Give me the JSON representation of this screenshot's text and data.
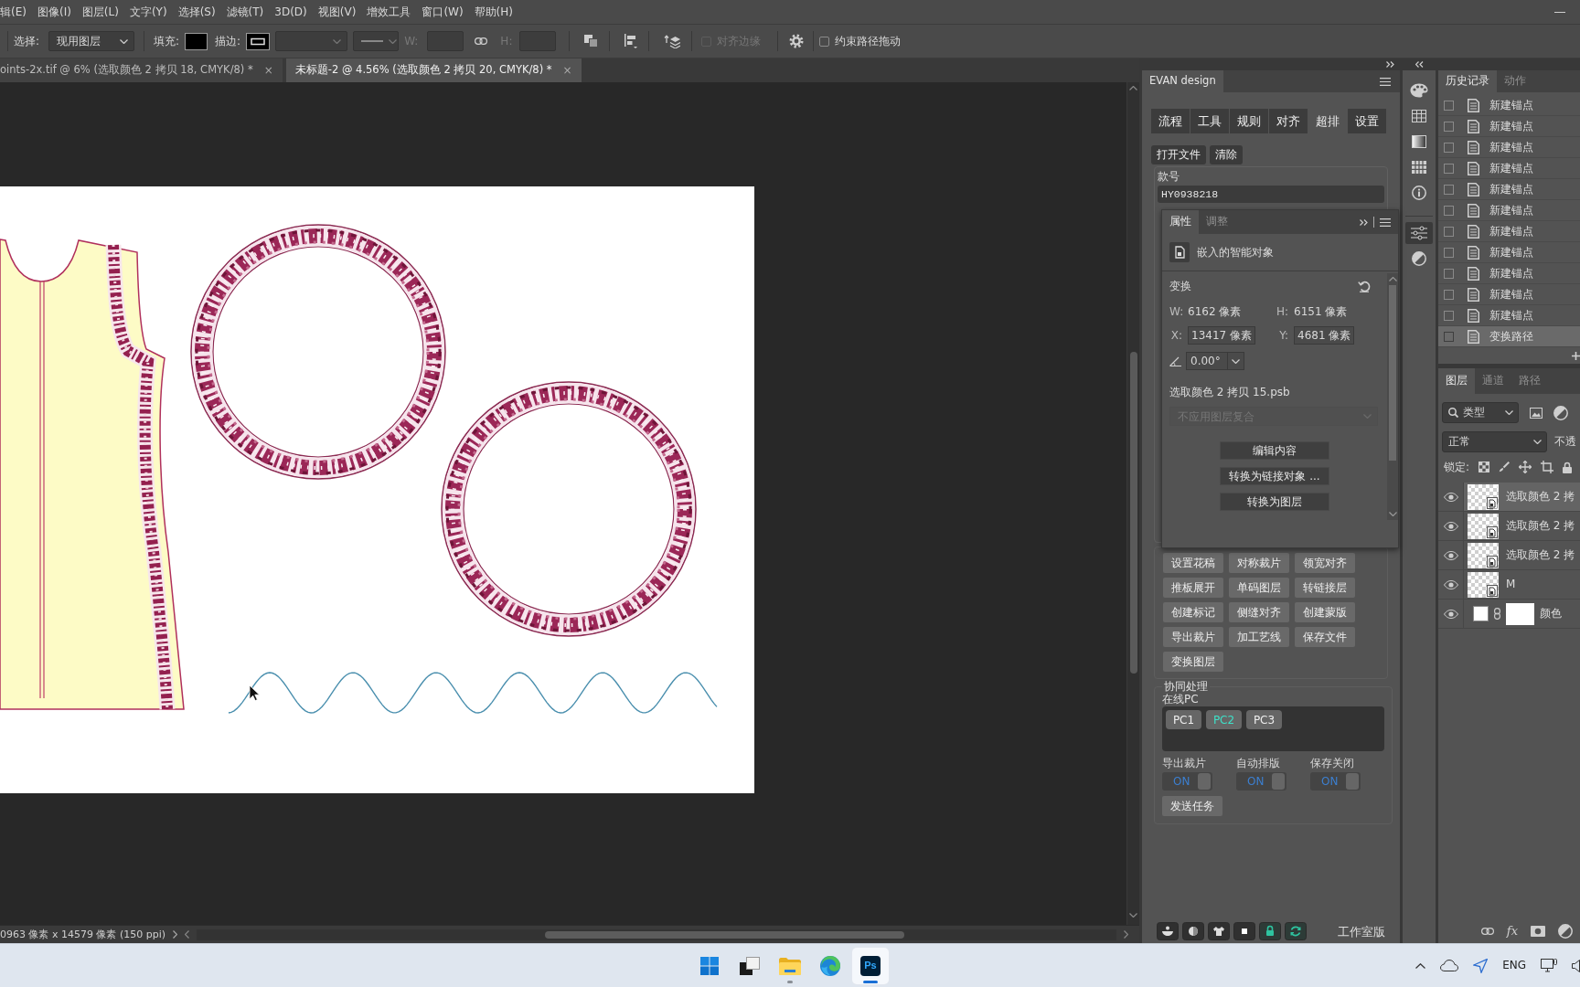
{
  "menu_bar": {
    "items": [
      "辑(E)",
      "图像(I)",
      "图层(L)",
      "文字(Y)",
      "选择(S)",
      "滤镜(T)",
      "3D(D)",
      "视图(V)",
      "增效工具",
      "窗口(W)",
      "帮助(H)"
    ]
  },
  "options_bar": {
    "select_label": "选择:",
    "select_value": "现用图层",
    "fill_label": "填充:",
    "stroke_label": "描边:",
    "w_label": "W:",
    "h_label": "H:",
    "align_edges": {
      "label": "对齐边缘",
      "checked": false,
      "disabled": true
    },
    "constrain_path": {
      "label": "约束路径拖动",
      "checked": false
    }
  },
  "document_tabs": [
    {
      "title": "oints-2x.tif @ 6% (选取颜色 2 拷贝 18, CMYK/8) *",
      "close": "×",
      "selected": false
    },
    {
      "title": "未标题-2 @ 4.56% (选取颜色 2 拷贝 20, CMYK/8) *",
      "close": "×",
      "selected": true
    }
  ],
  "status_bar": {
    "info": "0963 像素 x 14579 像素 (150 ppi)"
  },
  "evan_panel": {
    "title": "EVAN design",
    "tabs": [
      {
        "label": "流程",
        "selected": false
      },
      {
        "label": "工具",
        "selected": false
      },
      {
        "label": "规则",
        "selected": false
      },
      {
        "label": "对齐",
        "selected": false
      },
      {
        "label": "超排",
        "selected": true
      },
      {
        "label": "设置",
        "selected": false
      }
    ],
    "file_buttons": [
      "打开文件",
      "清除"
    ],
    "style_number": {
      "label": "款号",
      "value": "HY0938218"
    },
    "tool_buttons": [
      "设置花稿",
      "对称裁片",
      "领宽对齐",
      "推板展开",
      "单码图层",
      "转链接层",
      "创建标记",
      "侧缝对齐",
      "创建蒙版",
      "导出裁片",
      "加工艺线",
      "保存文件",
      "变换图层"
    ],
    "sync": {
      "title": "协同处理",
      "online_label": "在线PC",
      "pcs": [
        {
          "label": "PC1",
          "selected": false
        },
        {
          "label": "PC2",
          "selected": true
        },
        {
          "label": "PC3",
          "selected": false
        }
      ],
      "toggles": [
        {
          "label": "导出裁片",
          "text": "ON",
          "on": true
        },
        {
          "label": "自动排版",
          "text": "ON",
          "on": true
        },
        {
          "label": "保存关闭",
          "text": "ON",
          "on": true
        }
      ],
      "send_button": "发送任务"
    },
    "edition": "工作室版"
  },
  "properties_panel": {
    "tabs": [
      {
        "label": "属性",
        "selected": true
      },
      {
        "label": "调整",
        "selected": false
      }
    ],
    "object_type": "嵌入的智能对象",
    "section": "变换",
    "size": [
      {
        "label": "W:",
        "value": "6162 像素"
      },
      {
        "label": "H:",
        "value": "6151 像素"
      }
    ],
    "position": [
      {
        "label": "X:",
        "value": "13417 像素"
      },
      {
        "label": "Y:",
        "value": "4681 像素"
      }
    ],
    "angle": "0.00°",
    "file_name": "选取颜色 2 拷贝 15.psb",
    "layer_comp": {
      "value": "不应用图层复合",
      "disabled": true
    },
    "buttons": [
      "编辑内容",
      "转换为链接对象 ...",
      "转换为图层"
    ]
  },
  "history_panel": {
    "tabs": [
      {
        "label": "历史记录",
        "selected": true
      },
      {
        "label": "动作",
        "selected": false
      }
    ],
    "items": [
      {
        "label": "新建锚点",
        "selected": false
      },
      {
        "label": "新建锚点",
        "selected": false
      },
      {
        "label": "新建锚点",
        "selected": false
      },
      {
        "label": "新建锚点",
        "selected": false
      },
      {
        "label": "新建锚点",
        "selected": false
      },
      {
        "label": "新建锚点",
        "selected": false
      },
      {
        "label": "新建锚点",
        "selected": false
      },
      {
        "label": "新建锚点",
        "selected": false
      },
      {
        "label": "新建锚点",
        "selected": false
      },
      {
        "label": "新建锚点",
        "selected": false
      },
      {
        "label": "新建锚点",
        "selected": false
      },
      {
        "label": "变换路径",
        "selected": true
      }
    ]
  },
  "layers_panel": {
    "tabs": [
      {
        "label": "图层",
        "selected": true
      },
      {
        "label": "通道",
        "selected": false
      },
      {
        "label": "路径",
        "selected": false
      }
    ],
    "filter": "类型",
    "blend_mode": "正常",
    "opacity_label": "不透",
    "lock_label": "锁定:",
    "layers": [
      {
        "name": "选取颜色 2 拷",
        "kind": "smart",
        "visible": true,
        "selected": true
      },
      {
        "name": "选取颜色 2 拷",
        "kind": "smart",
        "visible": true,
        "selected": false
      },
      {
        "name": "选取颜色 2 拷",
        "kind": "smart",
        "visible": true,
        "selected": false
      },
      {
        "name": "M",
        "kind": "smart",
        "visible": true,
        "selected": false
      },
      {
        "name": "颜色",
        "kind": "fill",
        "visible": true,
        "selected": false
      }
    ],
    "fx": "fx"
  },
  "taskbar": {
    "apps": [
      {
        "kind": "start",
        "running": false,
        "active": false
      },
      {
        "kind": "task_view",
        "running": false,
        "active": false
      },
      {
        "kind": "explorer",
        "running": true,
        "active": false
      },
      {
        "kind": "browser",
        "running": false,
        "active": false
      },
      {
        "kind": "photoshop",
        "label": "Ps",
        "running": true,
        "active": true
      }
    ],
    "language": "ENG"
  }
}
